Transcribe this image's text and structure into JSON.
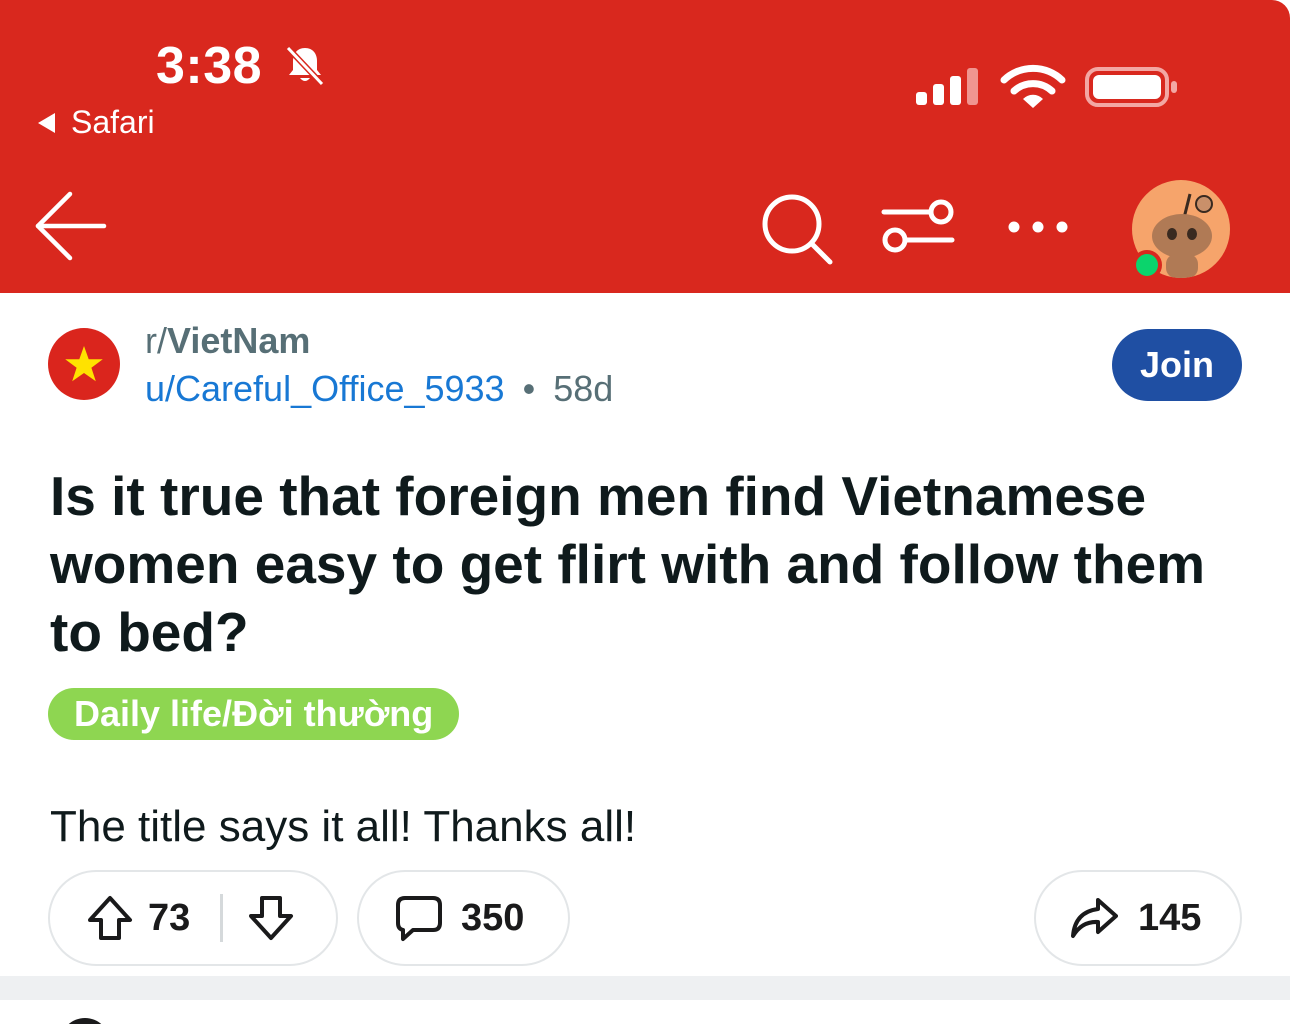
{
  "status_bar": {
    "time": "3:38",
    "back_app": "Safari",
    "icons": [
      "bell-slash-icon",
      "cellular-signal-icon",
      "wifi-icon",
      "battery-icon"
    ]
  },
  "nav": {
    "icons": [
      "back-arrow-icon",
      "search-icon",
      "filter-icon",
      "more-icon",
      "user-avatar"
    ]
  },
  "post": {
    "subreddit_prefix": "r/",
    "subreddit_name": "VietNam",
    "author": "u/Careful_Office_5933",
    "separator": "•",
    "age": "58d",
    "join_label": "Join",
    "title": "Is it true that foreign men find Vietnamese women easy to get flirt with and follow them to bed?",
    "flair": "Daily life/Đời thường",
    "body": "The title says it all! Thanks all!",
    "upvotes": "73",
    "comments": "350",
    "shares": "145"
  },
  "colors": {
    "header": "#d9281e",
    "join_button": "#1f4fa3",
    "flair": "#8ed651",
    "username": "#1878d4",
    "online": "#0bd46c"
  }
}
